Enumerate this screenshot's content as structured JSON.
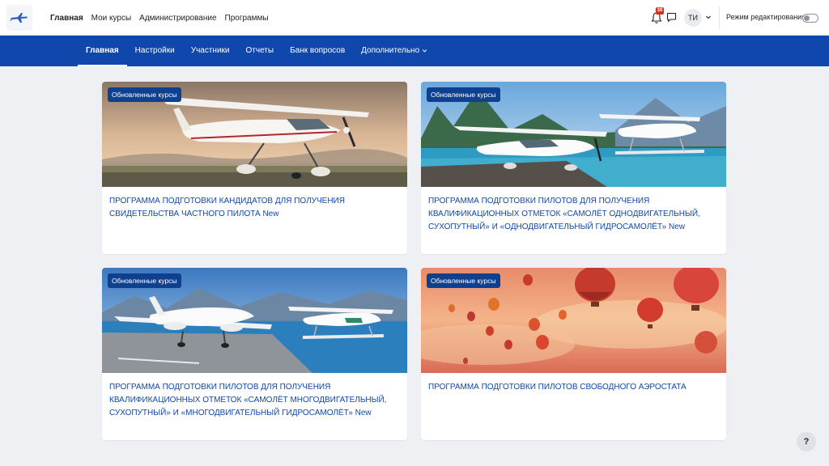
{
  "nav": {
    "items": [
      {
        "label": "Главная",
        "active": true
      },
      {
        "label": "Мои курсы"
      },
      {
        "label": "Администрирование"
      },
      {
        "label": "Программы"
      }
    ],
    "notifications_count": "38",
    "user_initials": "ТИ",
    "edit_mode_label": "Режим редактирования",
    "edit_mode_on": false
  },
  "subnav": {
    "items": [
      {
        "label": "Главная",
        "active": true
      },
      {
        "label": "Настройки"
      },
      {
        "label": "Участники"
      },
      {
        "label": "Отчеты"
      },
      {
        "label": "Банк вопросов"
      },
      {
        "label": "Дополнительно"
      }
    ]
  },
  "courses": [
    {
      "badge": "Обновленные курсы",
      "title": "ПРОГРАММА ПОДГОТОВКИ КАНДИДАТОВ ДЛЯ ПОЛУЧЕНИЯ СВИДЕТЕЛЬСТВА ЧАСТНОГО ПИЛОТА New"
    },
    {
      "badge": "Обновленные курсы",
      "title": "ПРОГРАММА ПОДГОТОВКИ ПИЛОТОВ ДЛЯ ПОЛУЧЕНИЯ КВАЛИФИКАЦИОННЫХ ОТМЕТОК «САМОЛЁТ ОДНОДВИГАТЕЛЬНЫЙ, СУХОПУТНЫЙ» И «ОДНОДВИГАТЕЛЬНЫЙ ГИДРОСАМОЛЁТ» New"
    },
    {
      "badge": "Обновленные курсы",
      "title": "ПРОГРАММА ПОДГОТОВКИ ПИЛОТОВ ДЛЯ ПОЛУЧЕНИЯ КВАЛИФИКАЦИОННЫХ ОТМЕТОК «САМОЛЁТ МНОГОДВИГАТЕЛЬНЫЙ, СУХОПУТНЫЙ» И «МНОГОДВИГАТЕЛЬНЫЙ ГИДРОСАМОЛЁТ» New"
    },
    {
      "badge": "Обновленные курсы",
      "title": "ПРОГРАММА ПОДГОТОВКИ ПИЛОТОВ СВОБОДНОГО АЭРОСТАТА"
    }
  ],
  "help_label": "?",
  "colors": {
    "brand_blue": "#0f47ad",
    "badge_bg": "#0f3f8f",
    "link": "#0f47ad",
    "notification": "#d93025"
  }
}
